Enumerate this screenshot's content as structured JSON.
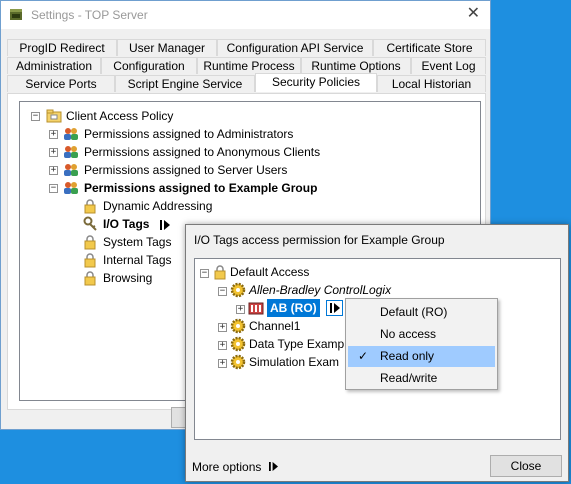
{
  "settings_window": {
    "title": "Settings - TOP Server",
    "tabs_row1": [
      "ProgID Redirect",
      "User Manager",
      "Configuration API Service",
      "Certificate Store"
    ],
    "tabs_row2": [
      "Administration",
      "Configuration",
      "Runtime Process",
      "Runtime Options",
      "Event Log"
    ],
    "tabs_row3": [
      "Service Ports",
      "Script Engine Service",
      "Security Policies",
      "Local Historian"
    ],
    "active_tab": "Security Policies",
    "tree": {
      "root": "Client Access Policy",
      "items": [
        "Permissions assigned to Administrators",
        "Permissions assigned to Anonymous Clients",
        "Permissions assigned to Server Users",
        "Permissions assigned to Example Group"
      ],
      "children": [
        "Dynamic Addressing",
        "I/O Tags",
        "System Tags",
        "Internal Tags",
        "Browsing"
      ]
    }
  },
  "dialog": {
    "title": "I/O Tags access permission for Example Group",
    "tree": {
      "root": "Default Access",
      "driver": "Allen-Bradley ControlLogix",
      "device": "AB (RO)",
      "items": [
        "Channel1",
        "Data Type Examp",
        "Simulation Exam"
      ]
    },
    "more_options": "More options",
    "close": "Close"
  },
  "context_menu": {
    "items": [
      "Default (RO)",
      "No access",
      "Read only",
      "Read/write"
    ],
    "checked": "Read only"
  },
  "colors": {
    "accent": "#0078d7",
    "desktop": "#1e8fe0",
    "highlight": "#9fcbff"
  }
}
